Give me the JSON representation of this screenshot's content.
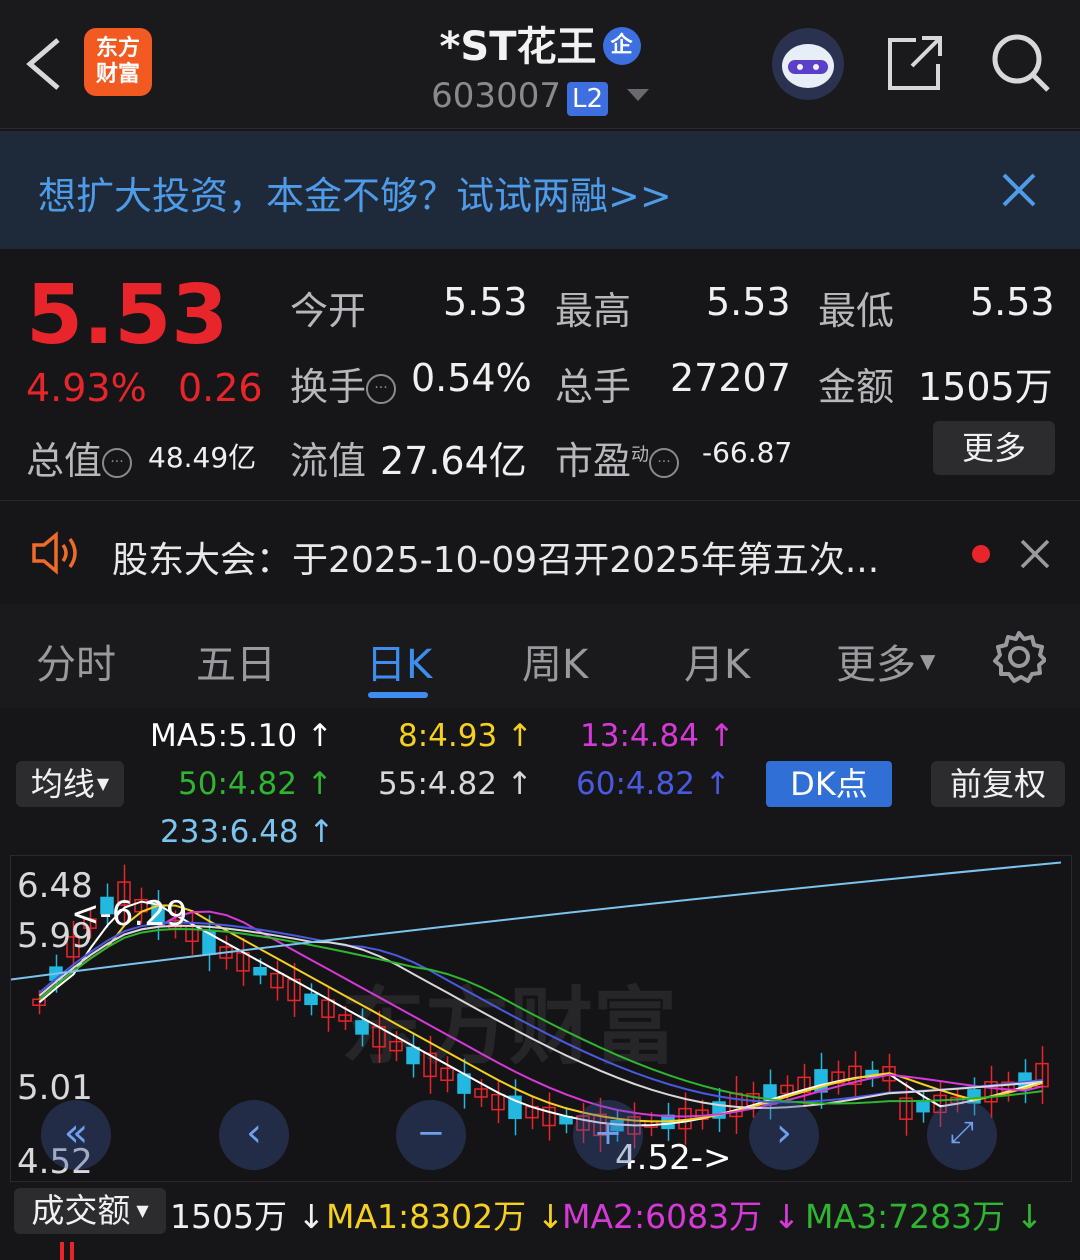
{
  "header": {
    "title": "*ST花王",
    "enterprise_badge": "企",
    "code": "603007",
    "level_badge": "L2",
    "logo_line1": "东方",
    "logo_line2": "财富"
  },
  "banner": {
    "text": "想扩大投资，本金不够？试试两融>>"
  },
  "quote": {
    "price": "5.53",
    "change_pct": "4.93%",
    "change": "0.26",
    "open_label": "今开",
    "open": "5.53",
    "high_label": "最高",
    "high": "5.53",
    "low_label": "最低",
    "low": "5.53",
    "turnover_label": "换手",
    "turnover": "0.54%",
    "volume_label": "总手",
    "volume": "27207",
    "amount_label": "金额",
    "amount": "1505万",
    "mktcap_label": "总值",
    "mktcap": "48.49亿",
    "float_label": "流值",
    "float": "27.64亿",
    "pe_label": "市盈",
    "pe_sup": "动",
    "pe": "-66.87",
    "more_label": "更多"
  },
  "announcement": {
    "text": "股东大会：于2025-10-09召开2025年第五次..."
  },
  "tabs": [
    {
      "label": "分时"
    },
    {
      "label": "五日"
    },
    {
      "label": "日K"
    },
    {
      "label": "周K"
    },
    {
      "label": "月K"
    },
    {
      "label": "更多"
    }
  ],
  "ma_legend": {
    "ma_btn": "均线",
    "ma5": "MA5:5.10 ↑",
    "ma8": "8:4.93 ↑",
    "ma13": "13:4.84 ↑",
    "ma50": "50:4.82 ↑",
    "ma55": "55:4.82 ↑",
    "ma60": "60:4.82 ↑",
    "ma233": "233:6.48 ↑",
    "dk_btn": "DK点",
    "adjust_btn": "前复权"
  },
  "colors": {
    "ma5": "#ffffff",
    "ma8": "#f5d020",
    "ma13": "#d63ad6",
    "ma50": "#2fb52f",
    "ma55": "#d8d8d8",
    "ma60": "#4a5ae0",
    "ma233": "#7cc4f0",
    "up": "#e8252b",
    "down": "#22b8e0"
  },
  "chart": {
    "y_top": "6.48",
    "y_upper": "5.99",
    "y_mid": "5.01",
    "y_bottom": "4.52",
    "max_marker": "<-6.29",
    "min_marker": "4.52->",
    "watermark": "东方财富"
  },
  "volume": {
    "selector": "成交额",
    "value": "1505万 ↓",
    "ma1": "MA1:8302万 ↓",
    "ma2": "MA2:6083万 ↓",
    "ma3": "MA3:7283万 ↓"
  }
}
